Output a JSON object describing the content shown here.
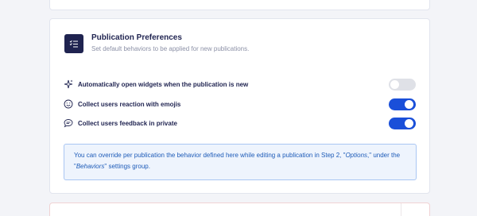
{
  "section": {
    "title": "Publication Preferences",
    "subtitle": "Set default behaviors to be applied for new publications."
  },
  "settings": [
    {
      "label": "Automatically open widgets when the publication is new",
      "enabled": false,
      "icon": "sparkles-icon"
    },
    {
      "label": "Collect users reaction with emojis",
      "enabled": true,
      "icon": "smiley-icon"
    },
    {
      "label": "Collect users feedback in private",
      "enabled": true,
      "icon": "chat-bubble-icon"
    }
  ],
  "info": {
    "part1": "You can override per publication the behavior defined here while editing a publication in Step 2, \"",
    "options": "Options",
    "part2": ",\" under the \"",
    "behaviors": "Behaviors",
    "part3": "\" settings group."
  },
  "colors": {
    "accent": "#1a4fd9",
    "title": "#1f2350",
    "info_text": "#1d5bb8",
    "info_bg": "#eef4fd"
  }
}
